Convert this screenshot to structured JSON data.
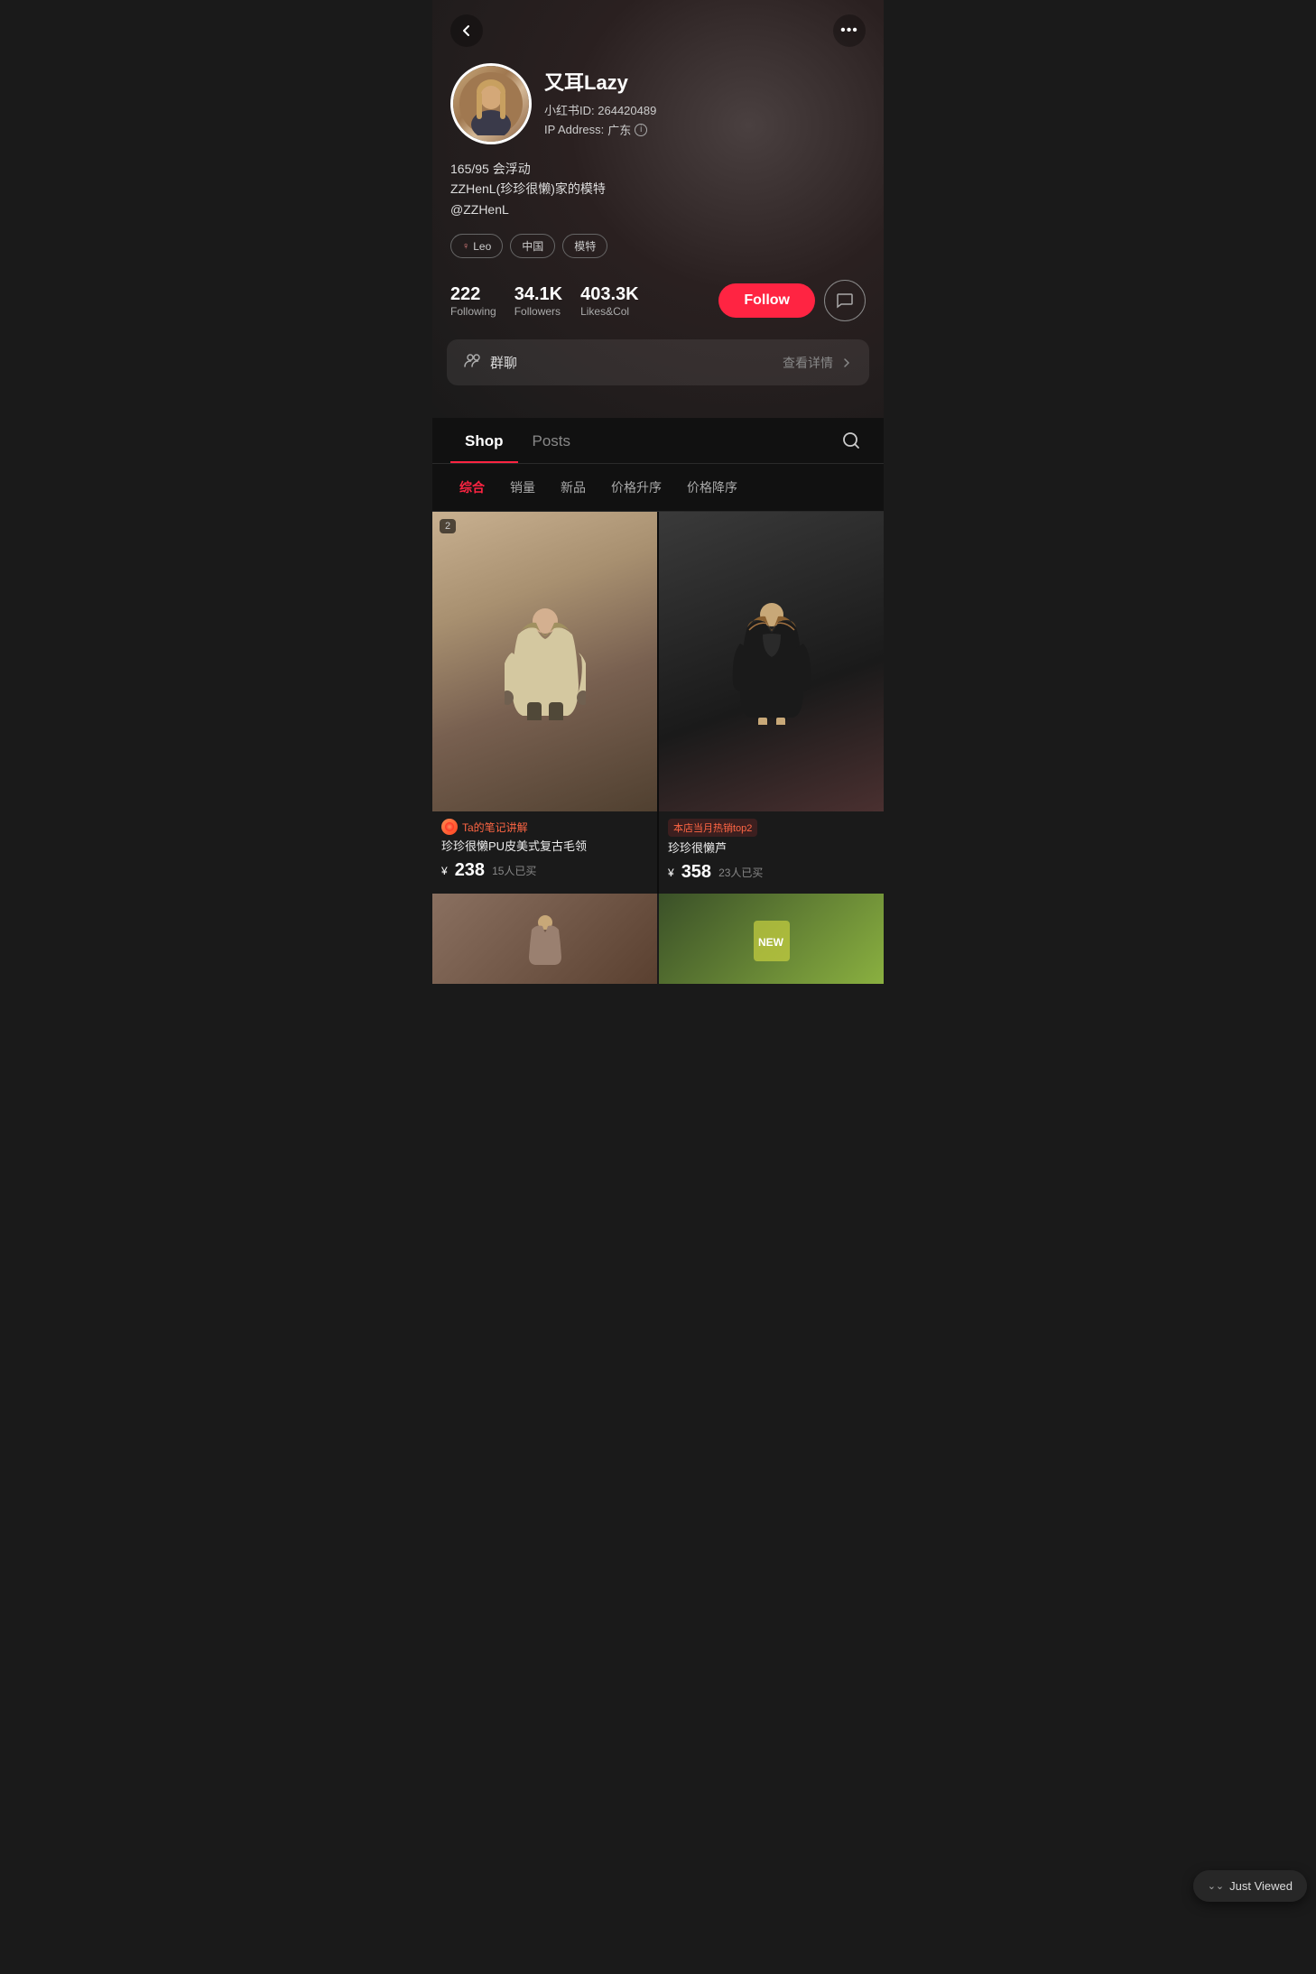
{
  "nav": {
    "back_label": "‹",
    "more_label": "•••"
  },
  "profile": {
    "name": "又耳Lazy",
    "xiaohongshu_id_label": "小红书ID:",
    "xiaohongshu_id": "264420489",
    "ip_label": "IP Address:",
    "ip_location": "广东",
    "bio_line1": "165/95 会浮动",
    "bio_line2": "ZZHenL(珍珍很懒)家的模特",
    "bio_line3": "@ZZHenL",
    "tags": [
      {
        "label": "Leo",
        "type": "zodiac"
      },
      {
        "label": "中国",
        "type": "country"
      },
      {
        "label": "模特",
        "type": "job"
      }
    ],
    "stats": {
      "following": {
        "number": "222",
        "label": "Following"
      },
      "followers": {
        "number": "34.1K",
        "label": "Followers"
      },
      "likes": {
        "number": "403.3K",
        "label": "Likes&Col"
      }
    },
    "follow_button": "Follow",
    "group_chat": {
      "icon": "👥",
      "label": "群聊",
      "detail_label": "查看详情"
    }
  },
  "tabs": {
    "items": [
      {
        "label": "Shop",
        "active": true
      },
      {
        "label": "Posts",
        "active": false
      }
    ],
    "search_icon": "🔍"
  },
  "filters": [
    {
      "label": "综合",
      "active": true
    },
    {
      "label": "销量",
      "active": false
    },
    {
      "label": "新品",
      "active": false
    },
    {
      "label": "价格升序",
      "active": false
    },
    {
      "label": "价格降序",
      "active": false
    }
  ],
  "products": [
    {
      "badge_num": "2",
      "badge_type": "Ta的笔记讲解",
      "title": "珍珍很懒PU皮美式复古毛领",
      "price_symbol": "¥",
      "price": "238",
      "sold": "15人已买",
      "hot": false,
      "img_class": "coat1"
    },
    {
      "badge_num": null,
      "badge_type": "本店当月热销top2",
      "title": "珍珍很懒芦",
      "price_symbol": "¥",
      "price": "358",
      "sold": "23人已买",
      "hot": true,
      "img_class": "coat2"
    }
  ],
  "just_viewed": {
    "label": "Just Viewed",
    "chevron": "⌄⌄"
  }
}
